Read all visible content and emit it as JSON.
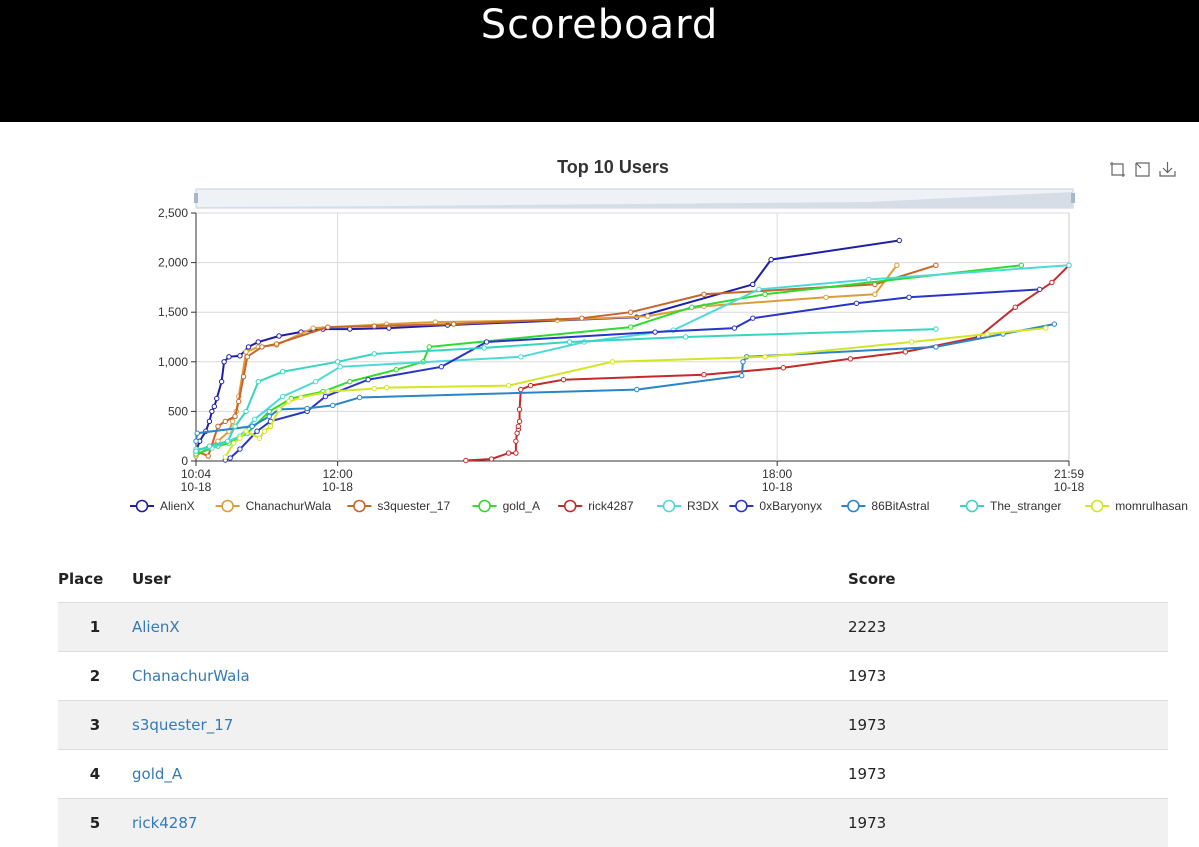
{
  "header": {
    "title": "Scoreboard"
  },
  "chart_title": "Top 10 Users",
  "toolbox": [
    "zoom-icon",
    "restore-icon",
    "download-icon"
  ],
  "chart_data": {
    "type": "line",
    "title": "Top 10 Users",
    "x_axis": {
      "type": "time",
      "min": "10-18 10:04",
      "max": "10-18 21:59",
      "ticks": [
        [
          "10:04",
          "10-18"
        ],
        [
          "12:00",
          "10-18"
        ],
        [
          "18:00",
          "10-18"
        ],
        [
          "21:59",
          "10-18"
        ]
      ]
    },
    "y_axis": {
      "min": 0,
      "max": 2500,
      "ticks": [
        "0",
        "500",
        "1,000",
        "1,500",
        "2,000",
        "2,500"
      ]
    },
    "grid": true,
    "legend_position": "bottom",
    "series": [
      {
        "name": "AlienX",
        "color": "#1f1ea6",
        "points": [
          [
            "10:04",
            100
          ],
          [
            "10:07",
            200
          ],
          [
            "10:12",
            300
          ],
          [
            "10:15",
            400
          ],
          [
            "10:17",
            500
          ],
          [
            "10:19",
            550
          ],
          [
            "10:21",
            630
          ],
          [
            "10:25",
            800
          ],
          [
            "10:27",
            1000
          ],
          [
            "10:31",
            1050
          ],
          [
            "10:40",
            1060
          ],
          [
            "10:47",
            1150
          ],
          [
            "10:55",
            1200
          ],
          [
            "11:12",
            1260
          ],
          [
            "11:30",
            1300
          ],
          [
            "11:48",
            1330
          ],
          [
            "12:10",
            1330
          ],
          [
            "12:42",
            1340
          ],
          [
            "13:30",
            1370
          ],
          [
            "16:05",
            1450
          ],
          [
            "17:40",
            1780
          ],
          [
            "17:55",
            2030
          ],
          [
            "19:40",
            2223
          ]
        ]
      },
      {
        "name": "ChanachurWala",
        "color": "#dd9c3a",
        "points": [
          [
            "10:04",
            50
          ],
          [
            "10:22",
            200
          ],
          [
            "10:31",
            300
          ],
          [
            "10:34",
            400
          ],
          [
            "10:37",
            500
          ],
          [
            "10:39",
            650
          ],
          [
            "10:45",
            1100
          ],
          [
            "10:55",
            1150
          ],
          [
            "11:10",
            1170
          ],
          [
            "11:40",
            1340
          ],
          [
            "12:40",
            1380
          ],
          [
            "13:20",
            1400
          ],
          [
            "15:00",
            1420
          ],
          [
            "16:14",
            1460
          ],
          [
            "17:00",
            1560
          ],
          [
            "18:40",
            1650
          ],
          [
            "19:20",
            1680
          ],
          [
            "19:38",
            1973
          ]
        ]
      },
      {
        "name": "s3quester_17",
        "color": "#c8652a",
        "points": [
          [
            "10:04",
            100
          ],
          [
            "10:14",
            50
          ],
          [
            "10:22",
            350
          ],
          [
            "10:28",
            400
          ],
          [
            "10:36",
            450
          ],
          [
            "10:39",
            600
          ],
          [
            "10:43",
            850
          ],
          [
            "10:46",
            1050
          ],
          [
            "10:58",
            1150
          ],
          [
            "11:10",
            1180
          ],
          [
            "11:52",
            1350
          ],
          [
            "12:30",
            1360
          ],
          [
            "13:35",
            1380
          ],
          [
            "15:20",
            1440
          ],
          [
            "16:00",
            1500
          ],
          [
            "17:00",
            1680
          ],
          [
            "19:20",
            1780
          ],
          [
            "20:10",
            1973
          ]
        ]
      },
      {
        "name": "gold_A",
        "color": "#2edb2e",
        "points": [
          [
            "10:04",
            70
          ],
          [
            "10:22",
            150
          ],
          [
            "10:31",
            180
          ],
          [
            "10:46",
            280
          ],
          [
            "11:04",
            500
          ],
          [
            "11:22",
            630
          ],
          [
            "11:48",
            700
          ],
          [
            "12:10",
            800
          ],
          [
            "12:48",
            920
          ],
          [
            "13:10",
            1000
          ],
          [
            "13:15",
            1150
          ],
          [
            "16:00",
            1350
          ],
          [
            "16:50",
            1550
          ],
          [
            "17:50",
            1680
          ],
          [
            "21:20",
            1973
          ]
        ]
      },
      {
        "name": "rick4287",
        "color": "#c42a2a",
        "points": [
          [
            "13:45",
            5
          ],
          [
            "14:06",
            20
          ],
          [
            "14:20",
            80
          ],
          [
            "14:26",
            80
          ],
          [
            "14:26",
            200
          ],
          [
            "14:27",
            280
          ],
          [
            "14:28",
            320
          ],
          [
            "14:28",
            350
          ],
          [
            "14:29",
            400
          ],
          [
            "14:29",
            520
          ],
          [
            "14:30",
            720
          ],
          [
            "14:38",
            760
          ],
          [
            "15:05",
            820
          ],
          [
            "17:00",
            870
          ],
          [
            "18:05",
            940
          ],
          [
            "19:00",
            1030
          ],
          [
            "19:45",
            1100
          ],
          [
            "20:45",
            1250
          ],
          [
            "21:15",
            1550
          ],
          [
            "21:45",
            1800
          ],
          [
            "21:59",
            1973
          ]
        ]
      },
      {
        "name": "R3DX",
        "color": "#4ed9d9",
        "points": [
          [
            "10:04",
            120
          ],
          [
            "10:17",
            130
          ],
          [
            "10:40",
            250
          ],
          [
            "10:52",
            420
          ],
          [
            "11:15",
            650
          ],
          [
            "11:42",
            800
          ],
          [
            "12:02",
            950
          ],
          [
            "14:30",
            1050
          ],
          [
            "15:22",
            1200
          ],
          [
            "16:35",
            1320
          ],
          [
            "17:45",
            1730
          ],
          [
            "19:15",
            1830
          ],
          [
            "21:59",
            1973
          ]
        ]
      },
      {
        "name": "0xBaryonyx",
        "color": "#2a35c8",
        "points": [
          [
            "10:28",
            10
          ],
          [
            "10:32",
            30
          ],
          [
            "10:40",
            120
          ],
          [
            "10:54",
            300
          ],
          [
            "11:05",
            400
          ],
          [
            "11:35",
            500
          ],
          [
            "11:50",
            650
          ],
          [
            "12:25",
            820
          ],
          [
            "13:25",
            950
          ],
          [
            "14:02",
            1200
          ],
          [
            "16:20",
            1300
          ],
          [
            "17:25",
            1340
          ],
          [
            "17:40",
            1440
          ],
          [
            "19:05",
            1590
          ],
          [
            "19:48",
            1650
          ],
          [
            "21:35",
            1730
          ]
        ]
      },
      {
        "name": "86BitAstral",
        "color": "#2a85c8",
        "points": [
          [
            "10:04",
            200
          ],
          [
            "10:05",
            280
          ],
          [
            "10:50",
            350
          ],
          [
            "11:04",
            450
          ],
          [
            "11:12",
            520
          ],
          [
            "11:35",
            530
          ],
          [
            "11:56",
            560
          ],
          [
            "12:18",
            640
          ],
          [
            "16:05",
            720
          ],
          [
            "17:31",
            860
          ],
          [
            "17:32",
            1000
          ],
          [
            "17:35",
            1050
          ],
          [
            "20:10",
            1150
          ],
          [
            "21:05",
            1280
          ],
          [
            "21:47",
            1380
          ]
        ]
      },
      {
        "name": "The_stranger",
        "color": "#35d6c0",
        "points": [
          [
            "10:04",
            100
          ],
          [
            "10:15",
            150
          ],
          [
            "10:30",
            200
          ],
          [
            "10:36",
            350
          ],
          [
            "10:45",
            500
          ],
          [
            "10:55",
            800
          ],
          [
            "11:15",
            900
          ],
          [
            "12:00",
            1000
          ],
          [
            "12:30",
            1080
          ],
          [
            "14:00",
            1140
          ],
          [
            "15:10",
            1200
          ],
          [
            "16:45",
            1250
          ],
          [
            "20:10",
            1330
          ]
        ]
      },
      {
        "name": "momrulhasan",
        "color": "#d2e623",
        "points": [
          [
            "10:28",
            40
          ],
          [
            "10:35",
            180
          ],
          [
            "10:40",
            230
          ],
          [
            "10:45",
            300
          ],
          [
            "10:56",
            230
          ],
          [
            "11:00",
            300
          ],
          [
            "11:05",
            350
          ],
          [
            "11:12",
            520
          ],
          [
            "11:20",
            600
          ],
          [
            "11:30",
            640
          ],
          [
            "11:52",
            700
          ],
          [
            "12:30",
            730
          ],
          [
            "12:40",
            740
          ],
          [
            "14:20",
            760
          ],
          [
            "15:45",
            1000
          ],
          [
            "17:50",
            1050
          ],
          [
            "19:50",
            1200
          ],
          [
            "20:52",
            1280
          ],
          [
            "21:40",
            1340
          ]
        ]
      }
    ]
  },
  "table": {
    "headers": {
      "place": "Place",
      "user": "User",
      "score": "Score"
    },
    "rows": [
      {
        "place": "1",
        "user": "AlienX",
        "score": "2223"
      },
      {
        "place": "2",
        "user": "ChanachurWala",
        "score": "1973"
      },
      {
        "place": "3",
        "user": "s3quester_17",
        "score": "1973"
      },
      {
        "place": "4",
        "user": "gold_A",
        "score": "1973"
      },
      {
        "place": "5",
        "user": "rick4287",
        "score": "1973"
      }
    ]
  }
}
